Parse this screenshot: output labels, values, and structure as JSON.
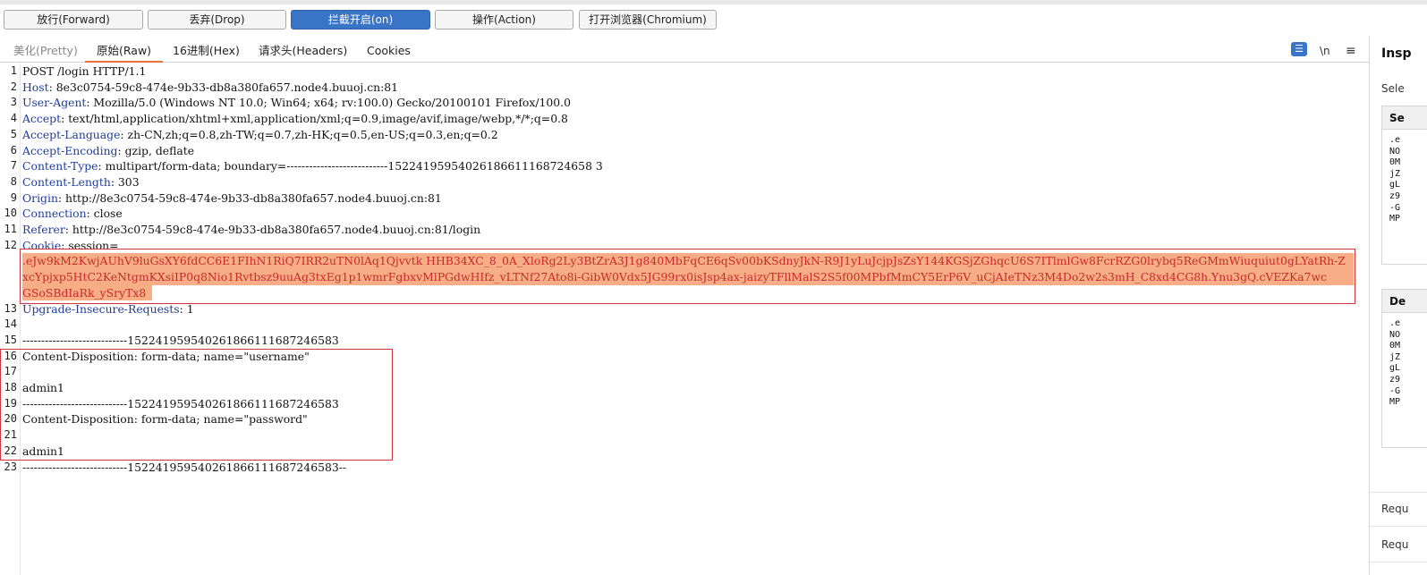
{
  "toolbar": {
    "forward": "放行(Forward)",
    "drop": "丢弃(Drop)",
    "intercept": "拦截开启(on)",
    "action": "操作(Action)",
    "browser": "打开浏览器(Chromium)"
  },
  "tabs": {
    "pretty": "美化(Pretty)",
    "raw": "原始(Raw)",
    "hex": "16进制(Hex)",
    "headers": "请求头(Headers)",
    "cookies": "Cookies",
    "newline_toggle": "\\n",
    "menu_icon": "menu-icon",
    "wrap_icon": "wrap-lines-icon",
    "accent_color": "#e8743b"
  },
  "request": {
    "lines": [
      {
        "num": "1",
        "key": "",
        "value": "POST /login HTTP/1.1"
      },
      {
        "num": "2",
        "key": "Host",
        "value": ": 8e3c0754-59c8-474e-9b33-db8a380fa657.node4.buuoj.cn:81"
      },
      {
        "num": "3",
        "key": "User-Agent",
        "value": ": Mozilla/5.0 (Windows NT 10.0; Win64; x64; rv:100.0) Gecko/20100101 Firefox/100.0"
      },
      {
        "num": "4",
        "key": "Accept",
        "value": ": text/html,application/xhtml+xml,application/xml;q=0.9,image/avif,image/webp,*/*;q=0.8"
      },
      {
        "num": "5",
        "key": "Accept-Language",
        "value": ": zh-CN,zh;q=0.8,zh-TW;q=0.7,zh-HK;q=0.5,en-US;q=0.3,en;q=0.2"
      },
      {
        "num": "6",
        "key": "Accept-Encoding",
        "value": ": gzip, deflate"
      },
      {
        "num": "7",
        "key": "Content-Type",
        "value": ": multipart/form-data; boundary=---------------------------15224195954026186611168724658 3"
      },
      {
        "num": "8",
        "key": "Content-Length",
        "value": ": 303"
      },
      {
        "num": "9",
        "key": "Origin",
        "value": ": http://8e3c0754-59c8-474e-9b33-db8a380fa657.node4.buuoj.cn:81"
      },
      {
        "num": "10",
        "key": "Connection",
        "value": ": close"
      },
      {
        "num": "11",
        "key": "Referer",
        "value": ": http://8e3c0754-59c8-474e-9b33-db8a380fa657.node4.buuoj.cn:81/login"
      },
      {
        "num": "12",
        "key": "Cookie",
        "value": ": session="
      }
    ],
    "cookie_value": [
      ".eJw9kM2KwjAUhV9luGsXY6fdCC6E1FIhN1RiQ7IRR2uTN0lAq1Qjvvtk HHB34XC_8_0A_XloRg2Ly3BtZrA3J1g840MbFqCE6qSv00bKSdnyJkN-R9J1yLuJcjpJsZsY144KGSjZGhqcU6S7ITlmlGw8FcrRZG0lrybq5ReGMmWiuquiut0gLYatRh-Z",
      "xcYpjxp5HtC2KeNtgmKXsiIP0q8Nio1Rvtbsz9uuAg3txEg1p1wmrFgbxvMlPGdwHIfz_vLTNf27Ato8i-GibW0Vdx5JG99rx0isJsp4ax-jaizyTFllMalS2S5f00MPbfMmCY5ErP6V_uCjAIeTNz3M4Do2w2s3mH_C8xd4CG8h.Ynu3gQ.cVEZKa7wc",
      "GSoSBdIaRk_ySryTx8"
    ],
    "after_lines": [
      {
        "num": "13",
        "key": "Upgrade-Insecure-Requests",
        "value": ": 1"
      },
      {
        "num": "14",
        "key": "",
        "value": ""
      },
      {
        "num": "15",
        "key": "",
        "value": "----------------------------152241959540261866111687246583"
      },
      {
        "num": "16",
        "key": "",
        "value": "Content-Disposition: form-data; name=\"username\""
      },
      {
        "num": "17",
        "key": "",
        "value": ""
      },
      {
        "num": "18",
        "key": "",
        "value": "admin1"
      },
      {
        "num": "19",
        "key": "",
        "value": "----------------------------152241959540261866111687246583"
      },
      {
        "num": "20",
        "key": "",
        "value": "Content-Disposition: form-data; name=\"password\""
      },
      {
        "num": "21",
        "key": "",
        "value": ""
      },
      {
        "num": "22",
        "key": "",
        "value": "admin1"
      },
      {
        "num": "23",
        "key": "",
        "value": "----------------------------152241959540261866111687246583--"
      }
    ],
    "key_color": "#1f3d9c",
    "highlight_color": "#f7ae86",
    "box_color": "#d2343c"
  },
  "inspector": {
    "title": "Insp",
    "selection": "Sele",
    "panel1_header": "Se",
    "panel1_lines": [
      ".e",
      "NO",
      "0M",
      "jZ",
      "gL",
      "z9",
      "-G",
      "MP"
    ],
    "panel2_header": "De",
    "panel2_lines": [
      ".e",
      "NO",
      "0M",
      "jZ",
      "gL",
      "z9",
      "-G",
      "MP"
    ],
    "req1": "Requ",
    "req2": "Requ"
  }
}
